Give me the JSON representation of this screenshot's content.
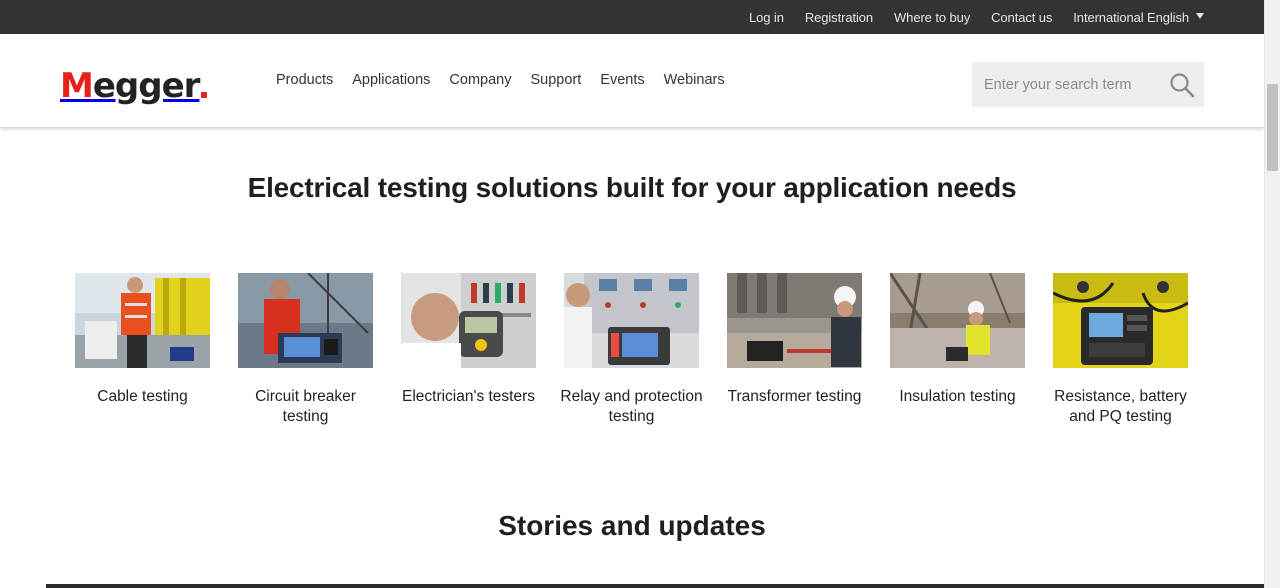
{
  "topbar": {
    "links": [
      "Log in",
      "Registration",
      "Where to buy",
      "Contact us"
    ],
    "language": "International English"
  },
  "header": {
    "logo": "Megger",
    "nav": [
      "Products",
      "Applications",
      "Company",
      "Support",
      "Events",
      "Webinars"
    ],
    "search_placeholder": "Enter your search term"
  },
  "main": {
    "title": "Electrical testing solutions built for your application needs",
    "applications": [
      {
        "label": "Cable testing"
      },
      {
        "label": "Circuit breaker testing"
      },
      {
        "label": "Electrician's testers"
      },
      {
        "label": "Relay and protection testing"
      },
      {
        "label": "Transformer testing"
      },
      {
        "label": "Insulation testing"
      },
      {
        "label": "Resistance, battery and PQ testing"
      }
    ],
    "stories_title": "Stories and updates"
  },
  "colors": {
    "brand_red": "#e4211a",
    "topbar_bg": "#333333",
    "search_bg": "#eeeeee"
  },
  "icons": [
    "search-icon",
    "chevron-down-icon"
  ]
}
